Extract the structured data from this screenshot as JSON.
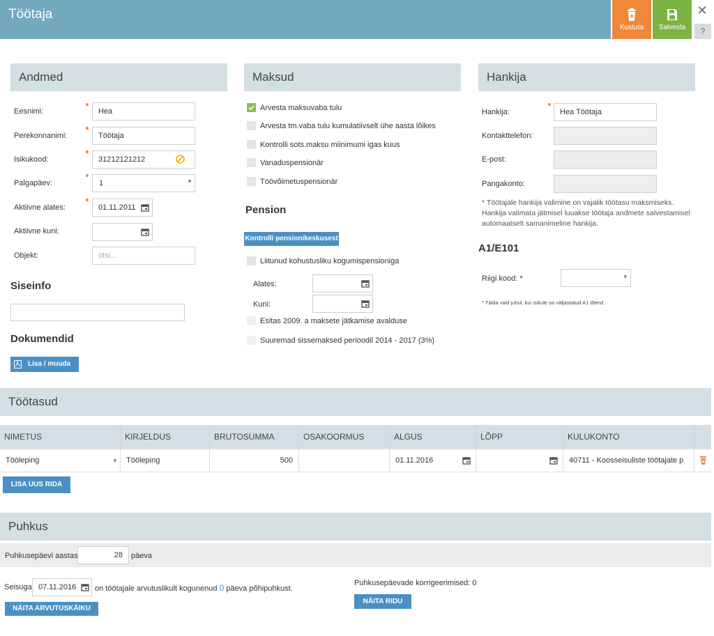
{
  "header": {
    "title": "Töötaja",
    "delete_label": "Kustuta",
    "save_label": "Salvesta",
    "close_glyph": "✕",
    "help_glyph": "?"
  },
  "andmed": {
    "title": "Andmed",
    "eesnimi_label": "Eesnimi:",
    "eesnimi_value": "Hea",
    "perekonnanimi_label": "Perekonnanimi:",
    "perekonnanimi_value": "Töötaja",
    "isikukood_label": "Isikukood:",
    "isikukood_value": "31212121212",
    "palgapaev_label": "Palgapäev:",
    "palgapaev_value": "1",
    "aktiivne_alates_label": "Aktiivne alates:",
    "aktiivne_alates_value": "01.11.2011",
    "aktiivne_kuni_label": "Aktiivne kuni:",
    "aktiivne_kuni_value": "",
    "objekt_label": "Objekt:",
    "objekt_placeholder": "otsi..."
  },
  "siseinfo": {
    "title": "Siseinfo",
    "value": ""
  },
  "dokumendid": {
    "title": "Dokumendid",
    "button_label": "Lisa / muuda"
  },
  "maksud": {
    "title": "Maksud",
    "options": [
      {
        "label": "Arvesta maksuvaba tulu",
        "checked": true
      },
      {
        "label": "Arvesta tm.vaba tulu kumulatiivselt ühe aasta lõikes",
        "checked": false
      },
      {
        "label": "Kontrolli sots.maksu miinimumi igas kuus",
        "checked": false
      },
      {
        "label": "Vanaduspensionär",
        "checked": false
      },
      {
        "label": "Töövõimetuspensionär",
        "checked": false
      }
    ]
  },
  "pension": {
    "title": "Pension",
    "check_button": "Kontrolli pensionikeskusest",
    "liitunud_label": "Liitunud kohustusliku kogumispensioniga",
    "alates_label": "Alates:",
    "alates_value": "",
    "kuni_label": "Kuni:",
    "kuni_value": "",
    "esitas_label": "Esitas 2009. a maksete jätkamise avalduse",
    "suuremad_label": "Suuremad sissemaksed perioodil 2014 - 2017 (3%)"
  },
  "hankija": {
    "title": "Hankija",
    "hankija_label": "Hankija:",
    "hankija_value": "Hea Töötaja",
    "kontakt_label": "Kontakttelefon:",
    "kontakt_value": "",
    "epost_label": "E-post:",
    "epost_value": "",
    "pangakonto_label": "Pangakonto:",
    "pangakonto_value": "",
    "note": "* Töötajale hankija valimine on vajalik töötasu maksmiseks. Hankija valimata jätmisel luuakse töötaja andmete salvestamisel automaatselt samanimeline hankija."
  },
  "a1": {
    "title": "A1/E101",
    "riigi_label": "Riigi kood: *",
    "riigi_value": "",
    "note": "* Täida vaid juhul, kui isikule on väljastatud A1 tõend."
  },
  "tootasud": {
    "title": "Töötasud",
    "columns": [
      "NIMETUS",
      "KIRJELDUS",
      "BRUTOSUMMA",
      "OSAKOORMUS",
      "ALGUS",
      "LÕPP",
      "KULUKONTO"
    ],
    "row": {
      "nimetus": "Tööleping",
      "kirjeldus": "Tööleping",
      "brutosumma": "500",
      "osakoormus": "",
      "algus": "01.11.2016",
      "lopp": "",
      "kulukonto": "40711 - Koosseisuliste töötajate p"
    },
    "add_button": "LISA UUS RIDA"
  },
  "puhkus": {
    "title": "Puhkus",
    "days_label": "Puhkusepäevi aastas:",
    "days_value": "28",
    "days_unit": "päeva",
    "seisuga_label": "Seisuga",
    "seisuga_value": "07.11.2016",
    "accrued_text_before": "on töötajale arvutuslikult kogunenud",
    "accrued_value": "0",
    "accrued_text_after": "päeva põhipuhkust.",
    "show_calc_button": "NÄITA ARVUTUSKÄIKU",
    "corrections_label": "Puhkusepäevade korrigeerimised: 0",
    "show_rows_button": "NÄITA RIDU"
  },
  "colors": {
    "header": "#72a9bd",
    "delete": "#f0883a",
    "save": "#7cb342",
    "section": "#d4dfe3",
    "button": "#4a90c4"
  }
}
